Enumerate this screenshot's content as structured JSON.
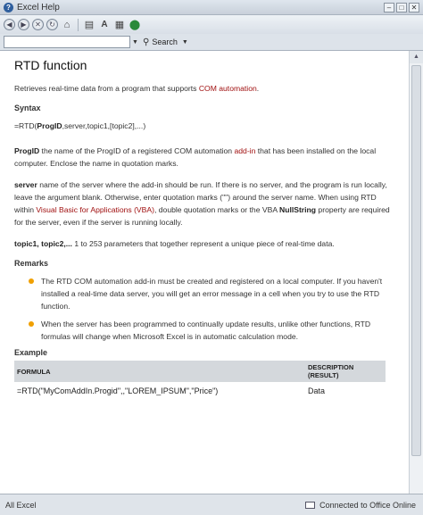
{
  "window": {
    "title": "Excel Help"
  },
  "search": {
    "value": "",
    "button_label": "Search"
  },
  "article": {
    "title": "RTD function",
    "intro_before": "Retrieves real-time data from a program that supports ",
    "intro_link": "COM automation",
    "intro_after": ".",
    "syntax_heading": "Syntax",
    "syntax_prefix": "=RTD(",
    "syntax_bold": "ProgID",
    "syntax_rest": ",server,topic1,[topic2],...)",
    "progid_term": "ProgID",
    "progid_text_1": "   the name of the ProgID of a registered COM automation ",
    "progid_link": "add-in",
    "progid_text_2": " that has been installed on the local computer. Enclose the name in quotation marks.",
    "server_term": "server",
    "server_text_1": "   name of the server where the add-in should be run. If there is no server, and the program is run locally, leave the argument blank. Otherwise, enter quotation marks (\"\") around the server name. When using RTD within ",
    "server_link": "Visual Basic for Applications (VBA)",
    "server_text_2": ", double quotation marks or the VBA ",
    "server_bold": "NullString",
    "server_text_3": " property are required for the server, even if the server is running locally.",
    "topic_term": "topic1, topic2,...",
    "topic_text": "   1 to 253 parameters that together represent a unique piece of real-time data.",
    "remarks_heading": "Remarks",
    "remarks": [
      "The RTD COM automation add-in must be created and registered on a local computer. If you haven't installed a real-time data server, you will get an error message in a cell when you try to use the RTD function.",
      "When the server has been programmed to continually update results, unlike other functions, RTD formulas will change when Microsoft Excel is in automatic calculation mode."
    ],
    "example_heading": "Example",
    "example_table": {
      "col_formula": "FORMULA",
      "col_description": "DESCRIPTION (RESULT)",
      "row_formula": "=RTD(\"MyComAddIn.Progid\",,\"LOREM_IPSUM\",\"Price\")",
      "row_description": "Data"
    }
  },
  "status": {
    "left": "All Excel",
    "right": "Connected to Office Online"
  },
  "colors": {
    "link": "#a01010",
    "bullet": "#f0a000",
    "table_header": "#d4d8dc"
  }
}
